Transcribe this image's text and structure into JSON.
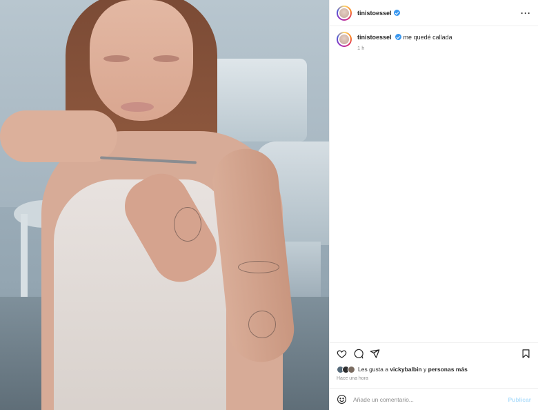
{
  "post": {
    "username": "tinistoessel",
    "verified": true,
    "more_icon": "more-horizontal-icon"
  },
  "caption": {
    "username": "tinistoessel",
    "text": "me quedé callada",
    "time": "1 h"
  },
  "actions": {
    "icons": [
      "heart-icon",
      "comment-icon",
      "share-icon",
      "bookmark-icon"
    ]
  },
  "likes": {
    "prefix": "Les gusta a",
    "user": "vickybalbin",
    "connector": "y",
    "others": "personas más"
  },
  "timestamp": "Hace una hora",
  "comment_box": {
    "placeholder": "Añade un comentario...",
    "publish_label": "Publicar"
  },
  "colors": {
    "verified": "#3897f0",
    "publish_disabled": "#b2dffc",
    "muted_text": "#8e8e8e"
  }
}
